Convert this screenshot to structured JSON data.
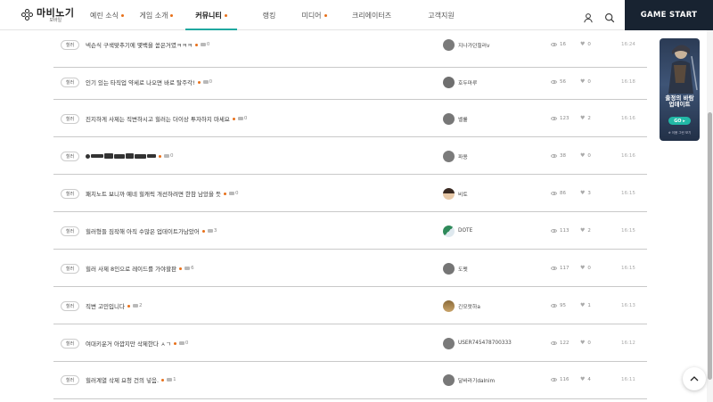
{
  "brand": {
    "title": "마비노기",
    "subtitle": "모바일"
  },
  "nav": [
    {
      "label": "예린 소식",
      "dot": true,
      "active": false
    },
    {
      "label": "게임 소개",
      "dot": true,
      "active": false
    },
    {
      "label": "커뮤니티",
      "dot": true,
      "active": true
    },
    {
      "label": "랭킹",
      "dot": false,
      "active": false
    },
    {
      "label": "미디어",
      "dot": true,
      "active": false
    },
    {
      "label": "크리에이터즈",
      "dot": false,
      "active": false
    },
    {
      "label": "고객지원",
      "dot": false,
      "active": false
    }
  ],
  "header": {
    "game_start": "GAME START",
    "user_icon": "user-icon",
    "search_icon": "search-icon"
  },
  "posts": [
    {
      "tag": "힐러",
      "title": "넥슨식 구색맞추기에 몇백을 쏟은거였ㅋㅋㅋ",
      "new": true,
      "comments": "0",
      "author": "지나가던힐러v",
      "views": "16",
      "likes": "0",
      "time": "16:24"
    },
    {
      "tag": "힐러",
      "title": "인기 있는 타직업 약세로 나오면 바로 탈주각!",
      "new": true,
      "comments": "0",
      "author": "호두마루",
      "views": "56",
      "likes": "0",
      "time": "16:18"
    },
    {
      "tag": "힐러",
      "title": "진지하게 사제는 직변하시고 힐러는 더이상 투자하지 마세요",
      "new": true,
      "comments": "0",
      "author": "벨룰",
      "views": "123",
      "likes": "2",
      "time": "16:16"
    },
    {
      "tag": "힐러",
      "title": "",
      "redacted": true,
      "new": true,
      "comments": "0",
      "author": "파용",
      "views": "38",
      "likes": "0",
      "time": "16:16"
    },
    {
      "tag": "힐러",
      "title": "패치노트 보니까 예네 힐캐릭 개선하려면 한참 남았을 듯",
      "new": true,
      "comments": "0",
      "author": "비토",
      "views": "86",
      "likes": "3",
      "time": "16:15"
    },
    {
      "tag": "힐러",
      "title": "힐러형들 짐작해 아직 수많은 업데이트가남았어",
      "new": true,
      "comments": "3",
      "author": "DOTE",
      "views": "113",
      "likes": "2",
      "time": "16:15"
    },
    {
      "tag": "힐러",
      "title": "힐러 사제 8인으로 레이드를 가야할판",
      "new": true,
      "comments": "6",
      "author": "도펫",
      "views": "117",
      "likes": "0",
      "time": "16:15"
    },
    {
      "tag": "힐러",
      "title": "직변 고민입니다",
      "new": true,
      "comments": "2",
      "author": "긴모랏하a",
      "views": "95",
      "likes": "1",
      "time": "16:13"
    },
    {
      "tag": "힐러",
      "title": "여대키운거 아깝지만 삭제한다 ㅅㄱ",
      "new": true,
      "comments": "0",
      "author": "USER745478700333",
      "views": "122",
      "likes": "0",
      "time": "16:12"
    },
    {
      "tag": "힐러",
      "title": "힐러계열 삭제 요청 건의 넣음.",
      "new": true,
      "comments": "1",
      "author": "달바라기dalnim",
      "views": "116",
      "likes": "4",
      "time": "16:11"
    }
  ],
  "ad": {
    "title_line1": "출정의 바람",
    "title_line2": "업데이트",
    "button": "GO ▸",
    "footnote": "※ 이용 그런 보기"
  },
  "colors": {
    "accent_dot": "#e8701a",
    "active_underline": "#1fa8a0",
    "game_start_bg": "#182331"
  }
}
